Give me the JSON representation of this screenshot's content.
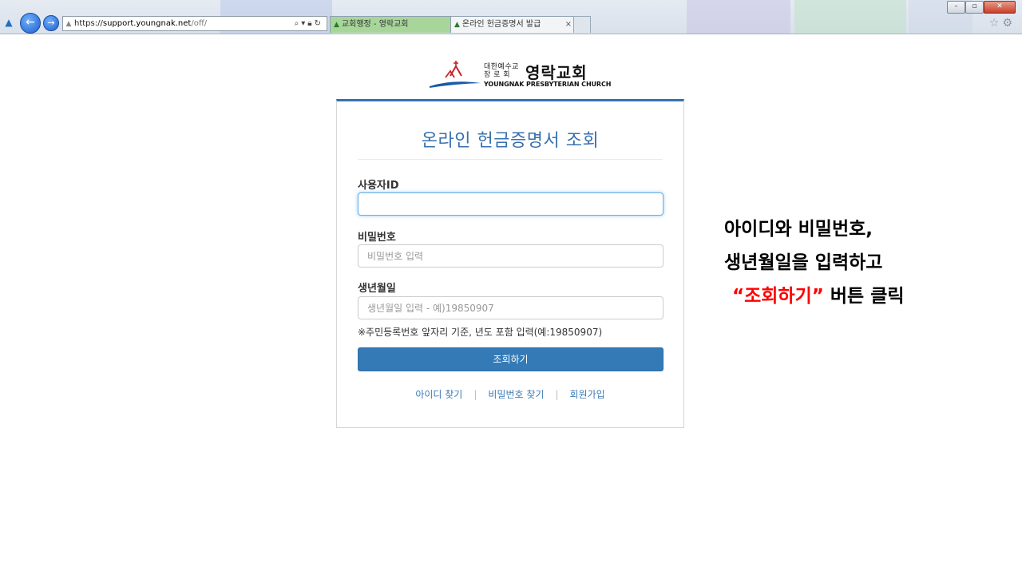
{
  "browser": {
    "address": {
      "scheme": "https://",
      "host": "support.youngnak.net",
      "path": "/off/"
    },
    "tabs": [
      {
        "label": "교회행정 - 영락교회",
        "active": false
      },
      {
        "label": "온라인 헌금증명서 발급",
        "active": true
      }
    ],
    "tab_close": "×",
    "window_controls": {
      "minimize": "–",
      "maximize": "▫",
      "close": "✕"
    },
    "icons": {
      "home": "home-icon",
      "favorites": "star-icon",
      "tools": "gear-icon"
    }
  },
  "logo": {
    "small_line1": "대한예수교",
    "small_line2": "장  로  회",
    "name_ko": "영락교회",
    "name_en": "YOUNGNAK PRESBYTERIAN CHURCH",
    "colors": {
      "cross": "#c8232c",
      "wave": "#1a5aa8"
    }
  },
  "form": {
    "title": "온라인 헌금증명서 조회",
    "user_id": {
      "label": "사용자ID",
      "value": "",
      "placeholder": ""
    },
    "password": {
      "label": "비밀번호",
      "value": "",
      "placeholder": "비밀번호 입력"
    },
    "birthdate": {
      "label": "생년월일",
      "value": "",
      "placeholder": "생년월일 입력 - 예)19850907"
    },
    "hint": "※주민등록번호 앞자리 기준, 년도 포함 입력(예:19850907)",
    "submit_label": "조회하기",
    "links": {
      "find_id": "아이디 찾기",
      "find_password": "비밀번호 찾기",
      "signup": "회원가입",
      "separator": "|"
    },
    "colors": {
      "primary": "#337ab7",
      "title": "#3771ae"
    }
  },
  "annotation": {
    "line1": "아이디와 비밀번호,",
    "line2": "생년월일을 입력하고",
    "line3_highlight": "“조회하기”",
    "line3_rest": " 버튼 클릭",
    "highlight_color": "#ff0000"
  }
}
